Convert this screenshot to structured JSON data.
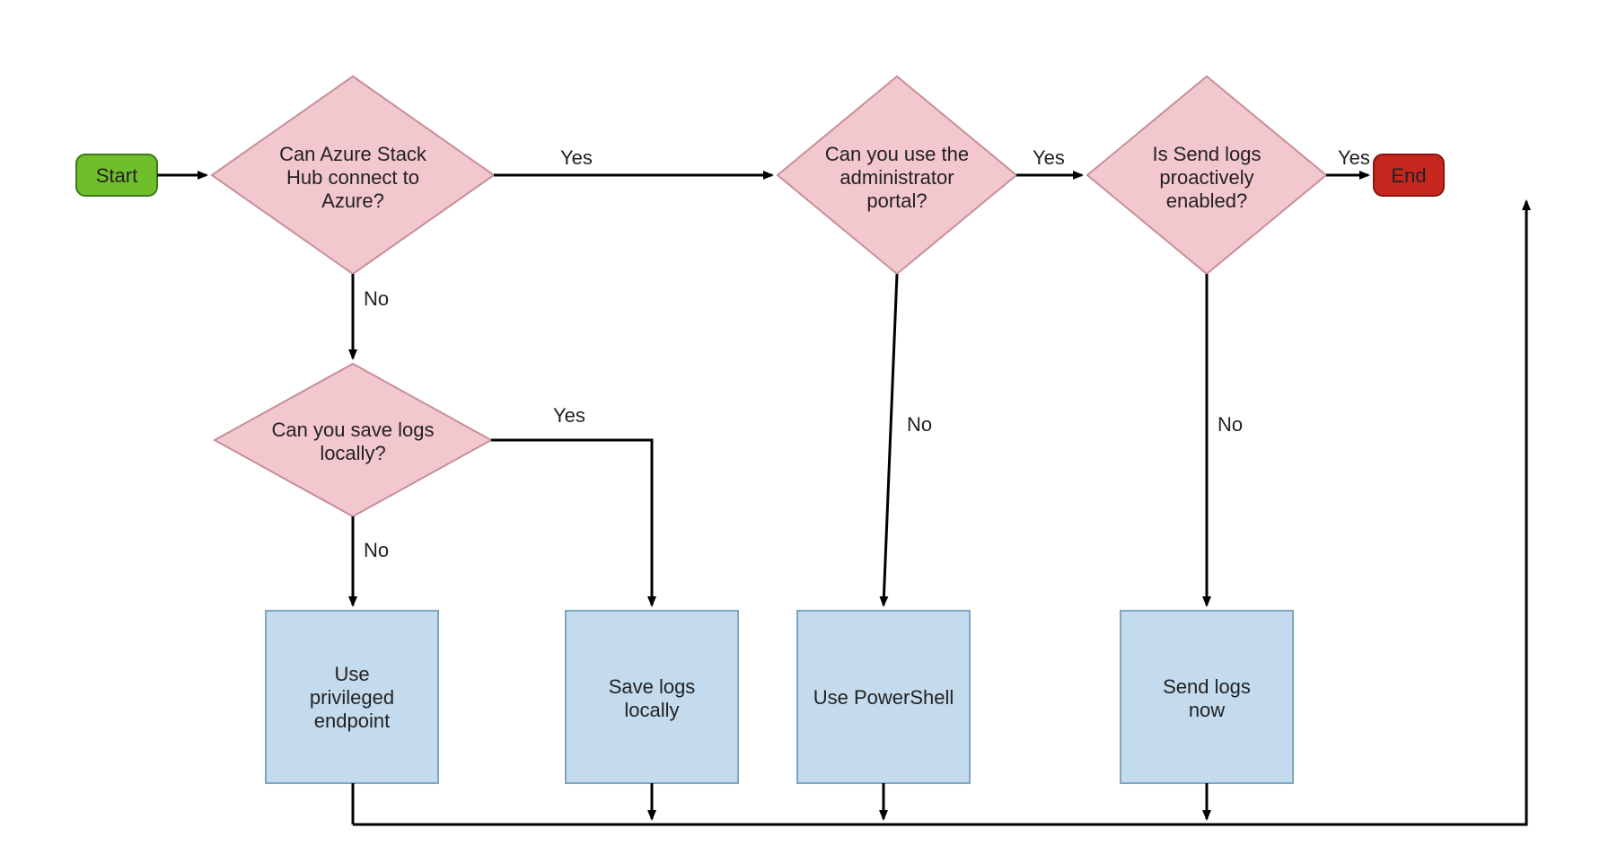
{
  "nodes": {
    "start": "Start",
    "end": "End",
    "d_connect": [
      "Can Azure Stack",
      "Hub connect to",
      "Azure?"
    ],
    "d_adminportal": [
      "Can you use the",
      "administrator",
      "portal?"
    ],
    "d_proactive": [
      "Is Send logs",
      "proactively",
      "enabled?"
    ],
    "d_savelocal": [
      "Can you save logs",
      "locally?"
    ],
    "p_privileged": [
      "Use",
      "privileged",
      "endpoint"
    ],
    "p_savelocal": [
      "Save logs",
      "locally"
    ],
    "p_powershell": [
      "Use PowerShell"
    ],
    "p_sendnow": [
      "Send logs",
      "now"
    ]
  },
  "labels": {
    "yes": "Yes",
    "no": "No"
  },
  "colors": {
    "start_fill": "#6fbf2c",
    "start_stroke": "#3e7a17",
    "end_fill": "#c7261f",
    "end_stroke": "#8a1410",
    "decision_fill": "#f3c7ce",
    "decision_stroke": "#c78f99",
    "process_fill": "#c4dbed",
    "process_stroke": "#7fa6c1",
    "line": "#000000"
  }
}
